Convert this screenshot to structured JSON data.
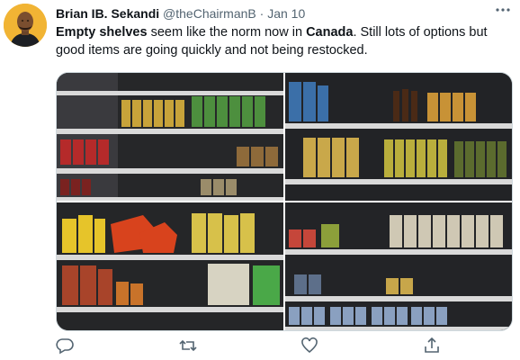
{
  "tweet": {
    "author_name": "Brian IB. Sekandi",
    "handle": "@theChairmanB",
    "separator": "·",
    "date": "Jan 10",
    "text_part1": "Empty shelves",
    "text_part2": " seem like the norm now in ",
    "text_part3": "Canada",
    "text_part4": ". Still lots of options but good items are going quickly and not being restocked."
  },
  "icons": {
    "more": "more-options-icon",
    "reply": "reply-icon",
    "retweet": "retweet-icon",
    "like": "like-icon",
    "share": "share-icon"
  },
  "media": {
    "photos": [
      "photo-shelves-canned",
      "photo-shelves-oil",
      "photo-shelves-pasta",
      "photo-shelves-tins"
    ]
  },
  "colors": {
    "text": "#0f1419",
    "muted": "#536471",
    "border": "#cfd9de",
    "avatar_bg": "#f1b434"
  }
}
